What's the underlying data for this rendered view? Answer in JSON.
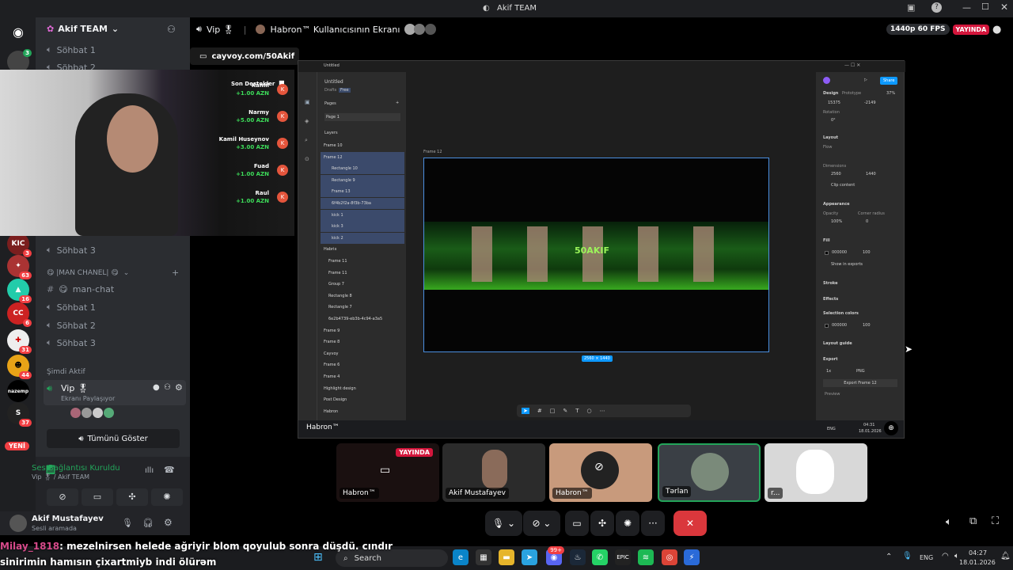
{
  "window": {
    "title": "Akif TEAM"
  },
  "server": {
    "name": "Akif TEAM"
  },
  "header": {
    "channel": "Vip 🎖",
    "screen_title": "Habron™ Kullanıcısının Ekranı",
    "quality": "1440p 60 FPS",
    "live": "YAYINDA"
  },
  "link_bar": {
    "url": "cayvoy.com/50Akif"
  },
  "channels": {
    "top": [
      "Söhbat 1",
      "Söhbat 2"
    ],
    "mid": "Söhbat 3",
    "category": "😋 |MAN CHANEL| 😋",
    "text_channel": "man-chat",
    "voice": [
      "Söhbat 1",
      "Söhbat 2",
      "Söhbat 3"
    ],
    "active_header": "Şimdi Aktif",
    "active_channel": "Vip 🎖",
    "active_sub": "Ekranı Paylaşıyor",
    "show_all": "Tümünü Göster"
  },
  "guild_badges": [
    "3",
    "63",
    "16",
    "6",
    "31",
    "44",
    "37"
  ],
  "guild_new": "YENİ",
  "guild_label": "nazemp",
  "voice_panel": {
    "status": "Ses Bağlantısı Kuruldu",
    "sub": "Vip 🎖 / Akif TEAM"
  },
  "user": {
    "name": "Akif Mustafayev",
    "status": "Sesli aramada"
  },
  "donations": {
    "title": "Son Destekler",
    "items": [
      {
        "name": "Kamil",
        "amount": "+1.00 AZN"
      },
      {
        "name": "Narmy",
        "amount": "+5.00 AZN"
      },
      {
        "name": "Kamil Huseynov",
        "amount": "+3.00 AZN"
      },
      {
        "name": "Fuad",
        "amount": "+1.00 AZN"
      },
      {
        "name": "Raul",
        "amount": "+1.00 AZN"
      }
    ]
  },
  "figma": {
    "file": "Untitled",
    "drafts": "Drafts",
    "free": "Free",
    "pages_label": "Pages",
    "page1": "Page 1",
    "layers_label": "Layers",
    "layers": [
      "Frame 10",
      "Frame 12",
      "Rectangle 10",
      "Rectangle 9",
      "Frame 13",
      "6f4b2f2a-8f3b-73ba",
      "kick 1",
      "kick 3",
      "kick 2",
      "Habrix",
      "Frame 11",
      "Frame 11",
      "Group 7",
      "Rectangle 8",
      "Rectangle 7",
      "6e2b4739-eb3b-4c94-a3a5",
      "Frame 9",
      "Frame 8",
      "Cayvoy",
      "Frame 6",
      "Frame 4",
      "Highlight design",
      "Post Design",
      "Habron"
    ],
    "frame_label": "Frame 12",
    "banner_text": "50AKIF",
    "dims": "2560 × 1440",
    "share": "Share",
    "design_tab": "Design",
    "prototype_tab": "Prototype",
    "zoom": "37%",
    "x": "15375",
    "y": "-2149",
    "rotation_label": "Rotation",
    "rotation": "0°",
    "layout": "Layout",
    "flow": "Flow",
    "dimensions": "Dimensions",
    "w": "2560",
    "h": "1440",
    "clip": "Clip content",
    "appearance": "Appearance",
    "opacity_label": "Opacity",
    "radius_label": "Corner radius",
    "opacity": "100%",
    "radius": "0",
    "fill": "Fill",
    "fill_hex": "000000",
    "fill_op": "100",
    "show_exports": "Show in exports",
    "stroke": "Stroke",
    "effects": "Effects",
    "sel_colors": "Selection colors",
    "sel_hex": "000000",
    "sel_op": "100",
    "layout_guide": "Layout guide",
    "export": "Export",
    "scale": "1x",
    "format": "PNG",
    "export_btn": "Export Frame 12",
    "preview": "Preview",
    "clock": "04:31",
    "date": "18.01.2026",
    "lang": "ENG",
    "sharer": "Habron™"
  },
  "participants": [
    {
      "label": "Habron™",
      "live": "YAYINDA"
    },
    {
      "label": "Akif Mustafayev"
    },
    {
      "label": "Habron™"
    },
    {
      "label": "Tərlan"
    },
    {
      "label": "r..."
    }
  ],
  "chat": {
    "user": "Milay_1818",
    "message": ": mezelnirsen helede ağriyir blom qoyulub sonra düşdü. cındır sinirimin hamısın çixartmiyb indi ölürəm"
  },
  "taskbar": {
    "search": "Search",
    "lang": "ENG",
    "time": "04:27",
    "date": "18.01.2026",
    "notif": "99+"
  },
  "colors": {
    "accent": "#5865f2",
    "live": "#d4163c",
    "green": "#23a55a",
    "figma_blue": "#0d99ff"
  }
}
